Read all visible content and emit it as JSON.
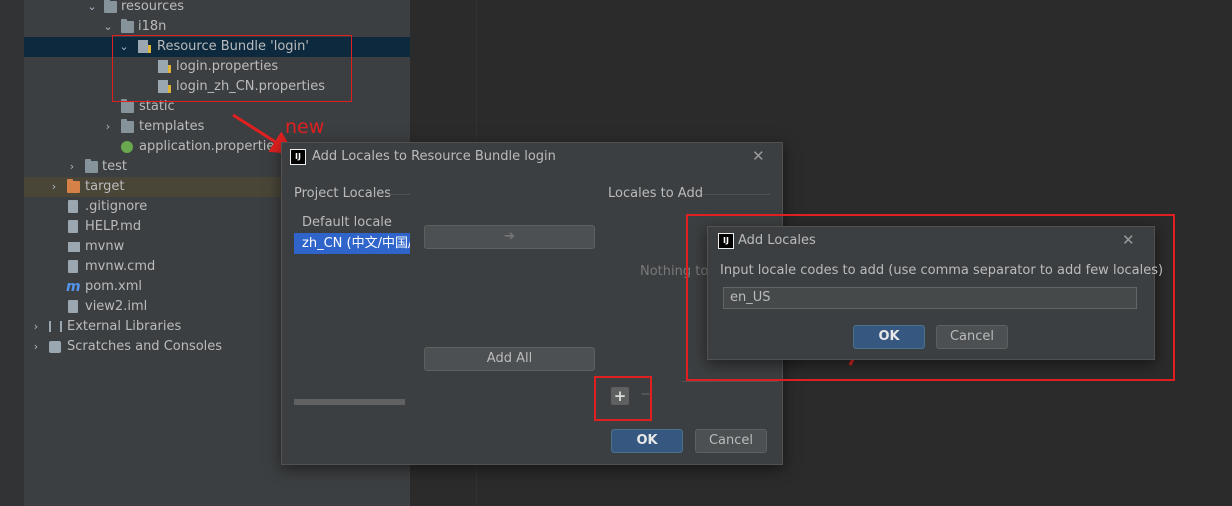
{
  "tree": {
    "items": [
      {
        "label": "resources"
      },
      {
        "label": "i18n"
      },
      {
        "label": "Resource Bundle 'login'"
      },
      {
        "label": "login.properties"
      },
      {
        "label": "login_zh_CN.properties"
      },
      {
        "label": "static"
      },
      {
        "label": "templates"
      },
      {
        "label": "application.properties"
      },
      {
        "label": "test"
      },
      {
        "label": "target"
      },
      {
        "label": ".gitignore"
      },
      {
        "label": "HELP.md"
      },
      {
        "label": "mvnw"
      },
      {
        "label": "mvnw.cmd"
      },
      {
        "label": "pom.xml"
      },
      {
        "label": "view2.iml"
      },
      {
        "label": "External Libraries"
      },
      {
        "label": "Scratches and Consoles"
      }
    ]
  },
  "annotation": {
    "new_label": "new",
    "color": "#e02020"
  },
  "main_dialog": {
    "logo": "IJ",
    "title": "Add Locales to Resource Bundle login",
    "project_locales_header": "Project Locales",
    "locales_to_add_header": "Locales to Add",
    "project_locales": [
      "Default locale",
      "zh_CN (中文/中国/)"
    ],
    "move_arrow": "➔",
    "add_all_label": "Add All",
    "empty_text": "Nothing to",
    "plus_label": "+",
    "minus_label": "−",
    "ok_label": "OK",
    "cancel_label": "Cancel"
  },
  "sub_dialog": {
    "logo": "IJ",
    "title": "Add Locales",
    "prompt": "Input locale codes to add (use comma separator to add few locales)",
    "input_value": "en_US",
    "ok_label": "OK",
    "cancel_label": "Cancel"
  },
  "colors": {
    "accent": "#365880",
    "selection": "#0d293e",
    "panel": "#3c3f41",
    "editor": "#2b2b2b"
  }
}
